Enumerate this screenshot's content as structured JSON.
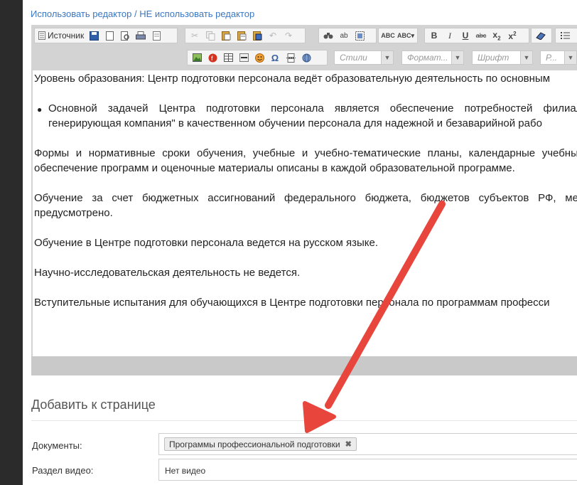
{
  "editor_links": {
    "use": "Использовать редактор",
    "separator": "/",
    "dont_use": "НЕ использовать редактор"
  },
  "toolbar": {
    "source_label": "Источник",
    "styles": "Стили",
    "format": "Формат...",
    "font": "Шрифт",
    "size": "Р..."
  },
  "content": {
    "p1": "Уровень образования: Центр подготовки персонала ведёт образовательную деятельность по основным",
    "bullet_l1": [
      "Основной",
      "задачей",
      "Центра",
      "подготовки",
      "персонала",
      "является",
      "обеспечение",
      "потребностей",
      "филиало"
    ],
    "bullet_l2": "генерирующая компания\" в качественном обучении персонала для надежной и безаварийной рабо",
    "p2_l1": [
      "Формы",
      "и",
      "нормативные",
      "сроки",
      "обучения,",
      "учебные",
      "и",
      "учебно-тематические",
      "планы,",
      "календарные",
      "учебны"
    ],
    "p2_l2": "обеспечение программ и оценочные материалы описаны в каждой образовательной программе.",
    "p3_l1": [
      "Обучение",
      "за",
      "счет",
      "бюджетных",
      "ассигнований",
      "федерального",
      "бюджета,",
      "бюджетов",
      "субъектов",
      "РФ,",
      "ме"
    ],
    "p3_l2": "предусмотрено.",
    "p4": "Обучение в Центре подготовки персонала ведется на русском языке.",
    "p5": "Научно-исследовательская деятельность не ведется.",
    "p6": "Вступительные испытания для обучающихся в Центре подготовки персонала по программам професси"
  },
  "add_section": {
    "title": "Добавить к странице",
    "documents_label": "Документы:",
    "documents_chip": "Программы профессиональной подготовки",
    "chip_remove": "✖",
    "video_label": "Раздел видео:",
    "video_value": "Нет видео"
  },
  "annotation_arrow_color": "#e8453c"
}
